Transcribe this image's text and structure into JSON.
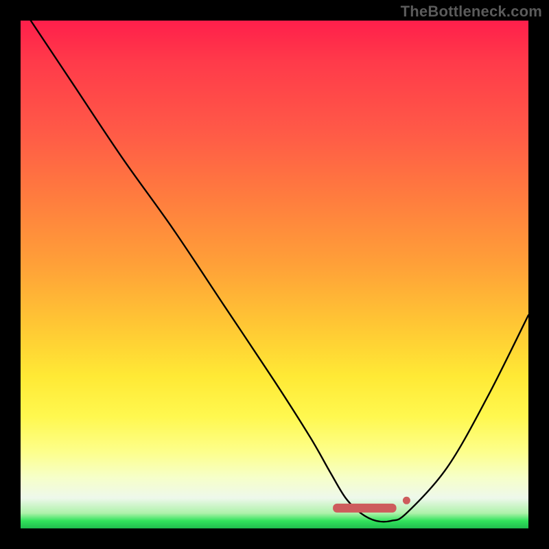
{
  "watermark": "TheBottleneck.com",
  "colors": {
    "gradient_top": "#ff1f4b",
    "gradient_mid": "#ffe935",
    "gradient_bottom": "#20bd4e",
    "curve": "#000000",
    "marker": "#cd5c5c",
    "background": "#000000"
  },
  "chart_data": {
    "type": "line",
    "title": "",
    "xlabel": "",
    "ylabel": "",
    "xlim": [
      0,
      100
    ],
    "ylim": [
      0,
      100
    ],
    "grid": false,
    "legend": false,
    "series": [
      {
        "name": "bottleneck-curve",
        "x": [
          2,
          10,
          20,
          30,
          40,
          50,
          57,
          61,
          64,
          67,
          70,
          73,
          76,
          84,
          92,
          100
        ],
        "y": [
          100,
          88,
          73,
          59,
          44,
          29,
          18,
          11,
          6,
          3,
          1.5,
          1.5,
          3,
          12,
          26,
          42
        ]
      }
    ],
    "markers": [
      {
        "name": "optimal-range-pill",
        "x_start": 61.5,
        "x_end": 74,
        "y": 4
      },
      {
        "name": "optimal-range-end-dot",
        "x": 76,
        "y": 5.5
      }
    ],
    "annotations": []
  }
}
